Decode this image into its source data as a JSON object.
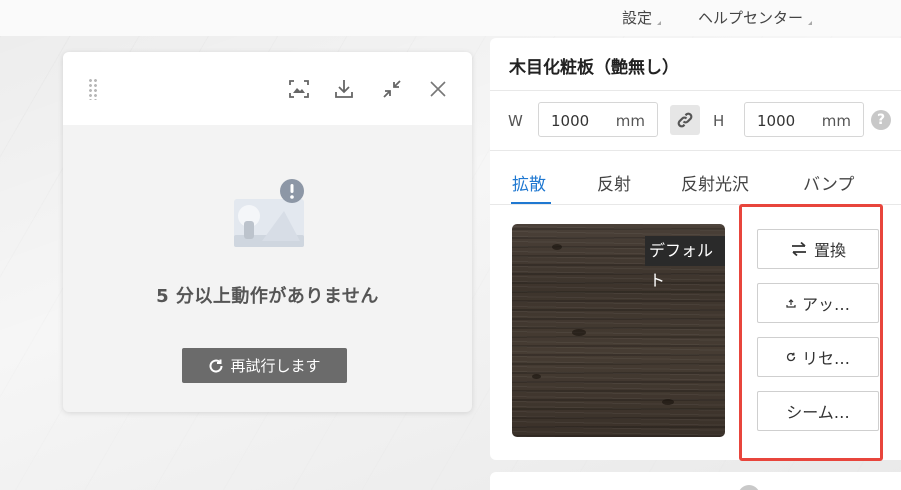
{
  "topbar": {
    "settings_label": "設定",
    "help_center_label": "ヘルプセンター"
  },
  "dialog": {
    "message": "5 分以上動作がありません",
    "retry_label": "再試行します",
    "header_icons": [
      "drag-handle-icon",
      "screenshot-icon",
      "download-icon",
      "shrink-icon",
      "close-icon"
    ]
  },
  "material": {
    "title": "木目化粧板（艶無し）",
    "width_label": "W",
    "width_value": "1000",
    "height_label": "H",
    "height_value": "1000",
    "unit": "mm",
    "help": "?",
    "tabs": [
      {
        "label": "拡散",
        "active": true
      },
      {
        "label": "反射",
        "active": false
      },
      {
        "label": "反射光沢",
        "active": false
      },
      {
        "label": "バンプ",
        "active": false
      }
    ],
    "texture_tag": "デフォルト",
    "actions": {
      "replace_label": "置換",
      "upload_label": "アッ…",
      "reset_label": "リセ…",
      "seamless_label": "シーム…"
    }
  },
  "colors": {
    "accent": "#1f78d1",
    "highlight_border": "#e8453c",
    "retry_bg": "#6b6b6b"
  }
}
